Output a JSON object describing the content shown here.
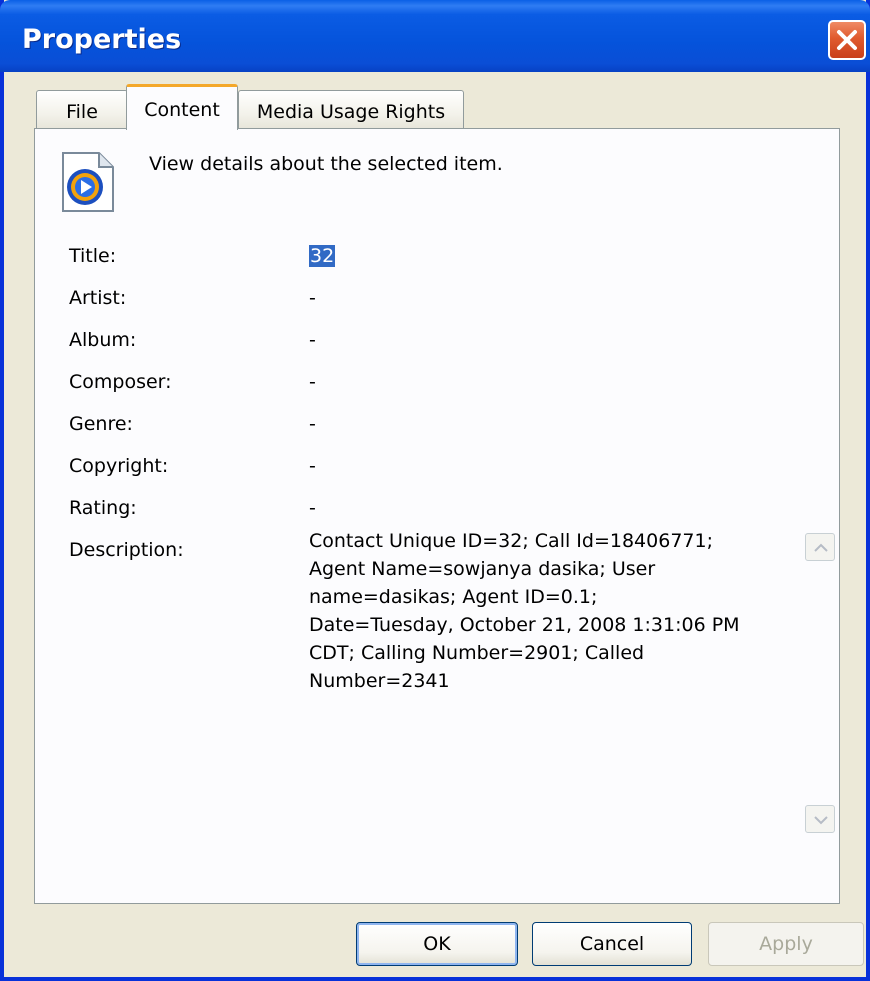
{
  "window": {
    "title": "Properties",
    "accent_color": "#0831d9",
    "close_icon": "close-icon"
  },
  "tabs": [
    {
      "label": "File",
      "selected": false
    },
    {
      "label": "Content",
      "selected": true
    },
    {
      "label": "Media Usage Rights",
      "selected": false
    }
  ],
  "content": {
    "icon": "windows-media-player-icon",
    "intro": "View details about the selected item.",
    "fields": [
      {
        "label": "Title:",
        "value": "32"
      },
      {
        "label": "Artist:",
        "value": "-"
      },
      {
        "label": "Album:",
        "value": "-"
      },
      {
        "label": "Composer:",
        "value": "-"
      },
      {
        "label": "Genre:",
        "value": "-"
      },
      {
        "label": "Copyright:",
        "value": "-"
      },
      {
        "label": "Rating:",
        "value": "-"
      },
      {
        "label": "Description:",
        "value": ""
      }
    ],
    "description_lines": [
      "Contact Unique ID=32; Call Id=18406771;",
      "Agent Name=sowjanya dasika; User",
      "name=dasikas; Agent ID=0.1;",
      "Date=Tuesday, October 21, 2008 1:31:06 PM",
      "CDT; Calling Number=2901; Called",
      "Number=2341"
    ]
  },
  "buttons": {
    "ok": "OK",
    "cancel": "Cancel",
    "apply": "Apply"
  }
}
